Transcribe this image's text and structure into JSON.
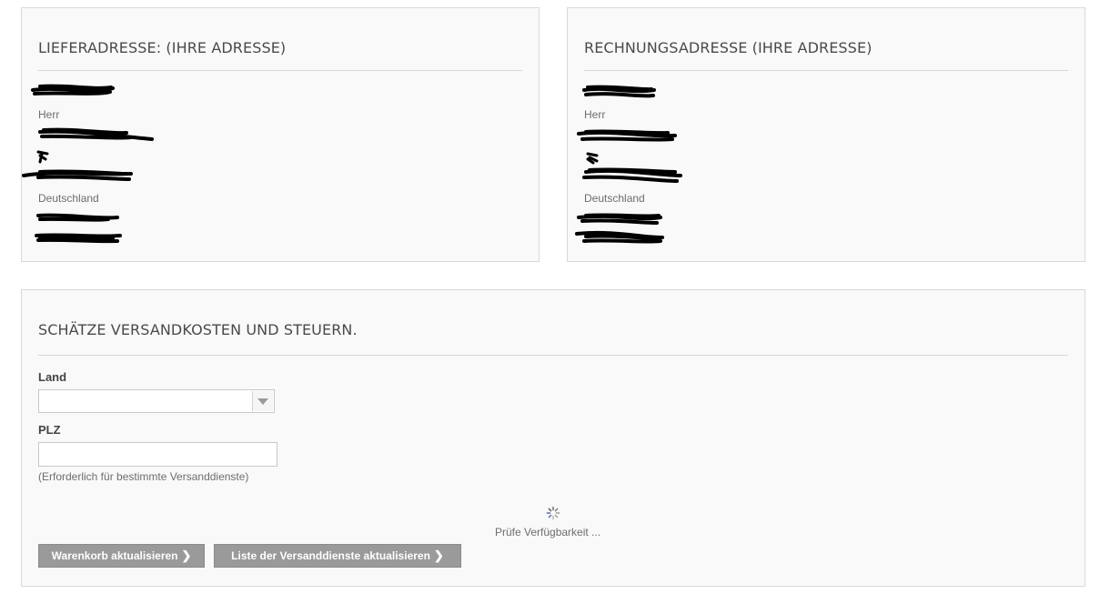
{
  "shipping": {
    "title": "LIEFERADRESSE: (IHRE ADRESSE)",
    "salutation": "Herr",
    "country": "Deutschland"
  },
  "billing": {
    "title": "RECHNUNGSADRESSE (IHRE ADRESSE)",
    "salutation": "Herr",
    "country": "Deutschland"
  },
  "estimate": {
    "title": "SCHÄTZE VERSANDKOSTEN UND STEUERN.",
    "country_label": "Land",
    "country_value": "",
    "zip_label": "PLZ",
    "zip_value": "",
    "zip_hint": "(Erforderlich für bestimmte Versanddienste)",
    "status": "Prüfe Verfügbarkeit ...",
    "update_cart_label": "Warenkorb aktualisieren",
    "update_shipping_label": "Liste der Versanddienste aktualisieren",
    "button_icon": "chevron-right-icon"
  }
}
